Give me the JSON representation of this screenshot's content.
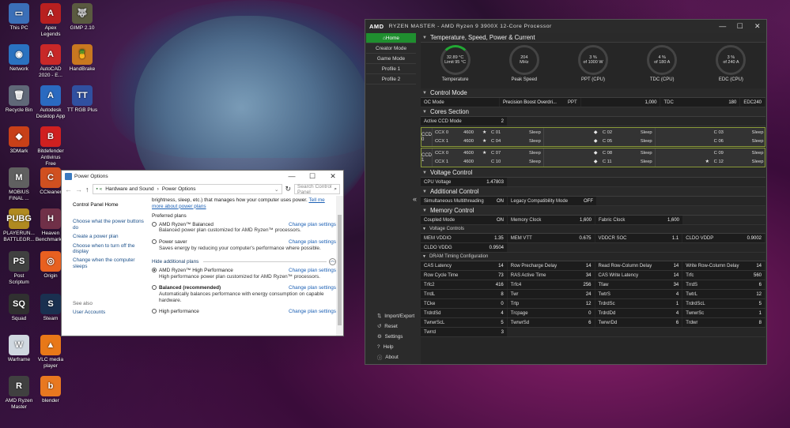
{
  "desktop": {
    "icons": [
      {
        "label": "This PC",
        "glyph": "▭",
        "color": "#3b6fb8"
      },
      {
        "label": "Apex Legends",
        "glyph": "A",
        "color": "#b82020"
      },
      {
        "label": "GIMP 2.10",
        "glyph": "🐺",
        "color": "#5a5a40"
      },
      {
        "label": "Network",
        "glyph": "◉",
        "color": "#2a72c0"
      },
      {
        "label": "AutoCAD 2020 - E...",
        "glyph": "A",
        "color": "#c82828"
      },
      {
        "label": "HandBrake",
        "glyph": "🍍",
        "color": "#c87820"
      },
      {
        "label": "Recycle Bin",
        "glyph": "🗑",
        "color": "#606878"
      },
      {
        "label": "Autodesk Desktop App",
        "glyph": "A",
        "color": "#2a6ac0"
      },
      {
        "label": "TT RGB Plus",
        "glyph": "TT",
        "color": "#3050a0"
      },
      {
        "label": "3DMark",
        "glyph": "◆",
        "color": "#c84018"
      },
      {
        "label": "Bitdefender Antivirus Free",
        "glyph": "B",
        "color": "#d02020"
      },
      {
        "label": "MOBIUS FINAL ...",
        "glyph": "M",
        "color": "#606060"
      },
      {
        "label": "CCleaner",
        "glyph": "C",
        "color": "#d05020"
      },
      {
        "label": "PLAYERUN... BATTLEGR...",
        "glyph": "PUBG",
        "color": "#b08a20"
      },
      {
        "label": "Heaven Benchmark...",
        "glyph": "H",
        "color": "#703048"
      },
      {
        "label": "Post Scriptum",
        "glyph": "PS",
        "color": "#404040"
      },
      {
        "label": "Origin",
        "glyph": "◎",
        "color": "#e86020"
      },
      {
        "label": "Squad",
        "glyph": "SQ",
        "color": "#303030"
      },
      {
        "label": "Steam",
        "glyph": "S",
        "color": "#1a3050"
      },
      {
        "label": "Warframe",
        "glyph": "W",
        "color": "#d0d8e0"
      },
      {
        "label": "VLC media player",
        "glyph": "▲",
        "color": "#e87818"
      },
      {
        "label": "AMD Ryzen Master",
        "glyph": "R",
        "color": "#404040"
      },
      {
        "label": "blender",
        "glyph": "b",
        "color": "#e87820"
      }
    ]
  },
  "power": {
    "title": "Power Options",
    "breadcrumb": [
      "Hardware and Sound",
      "Power Options"
    ],
    "search_placeholder": "Search Control Panel",
    "side_home": "Control Panel Home",
    "side_links": [
      "Choose what the power buttons do",
      "Create a power plan",
      "Choose when to turn off the display",
      "Change when the computer sleeps"
    ],
    "see_also": "See also",
    "user_accounts": "User Accounts",
    "intro": "brightness, sleep, etc.) that manages how your computer uses power.",
    "intro_link": "Tell me more about power plans",
    "preferred": "Preferred plans",
    "hide_additional": "Hide additional plans",
    "change_plan": "Change plan settings",
    "plans_pref": [
      {
        "name": "AMD Ryzen™ Balanced",
        "desc": "Balanced power plan customized for AMD Ryzen™ processors.",
        "selected": false
      },
      {
        "name": "Power saver",
        "desc": "Saves energy by reducing your computer's performance where possible.",
        "selected": false
      }
    ],
    "plans_add": [
      {
        "name": "AMD Ryzen™ High Performance",
        "desc": "High performance power plan customized for AMD Ryzen™ processors.",
        "selected": true
      },
      {
        "name": "Balanced (recommended)",
        "desc": "Automatically balances performance with energy consumption on capable hardware.",
        "selected": false
      },
      {
        "name": "High performance",
        "desc": "",
        "selected": false
      }
    ]
  },
  "rm": {
    "logo": "AMD",
    "title": "RYZEN MASTER  -  AMD Ryzen 9 3900X 12-Core Processor",
    "nav": [
      "Home",
      "Creator Mode",
      "Game Mode",
      "Profile 1",
      "Profile 2"
    ],
    "nav_bottom": [
      {
        "i": "⇅",
        "l": "Import/Export"
      },
      {
        "i": "↺",
        "l": "Reset"
      },
      {
        "i": "⚙",
        "l": "Settings"
      },
      {
        "i": "?",
        "l": "Help"
      },
      {
        "i": "ⓘ",
        "l": "About"
      }
    ],
    "sec_tsp": "Temperature, Speed, Power & Current",
    "gauges": [
      {
        "v1": "32.89 °C",
        "v2": "Limit 95 °C",
        "label": "Temperature",
        "style": "lo"
      },
      {
        "v1": "204",
        "v2": "MHz",
        "label": "Peak Speed",
        "style": "none"
      },
      {
        "v1": "3 %",
        "v2": "of 1000 W",
        "label": "PPT (CPU)",
        "style": "none"
      },
      {
        "v1": "4 %",
        "v2": "of 180 A",
        "label": "TDC (CPU)",
        "style": "none"
      },
      {
        "v1": "3 %",
        "v2": "of 240 A",
        "label": "EDC (CPU)",
        "style": "none"
      }
    ],
    "sec_control": "Control Mode",
    "oc_mode_label": "OC Mode",
    "oc_mode_value": "Precision Boost Overdri...",
    "ppt_label": "PPT",
    "ppt_value": "1,000",
    "tdc_label": "TDC",
    "tdc_value": "180",
    "edc_label": "EDC",
    "edc_value": "240",
    "sec_cores": "Cores Section",
    "active_ccd_label": "Active CCD Mode",
    "active_ccd_value": "2",
    "ccds": [
      {
        "name": "CCD 0",
        "cores": [
          {
            "ccx": "CCX 0",
            "mhz": "4600",
            "star": "★",
            "core": "C 01",
            "state": "Sleep"
          },
          {
            "ccx": "",
            "mhz": "",
            "star": "◆",
            "core": "C 02",
            "state": "Sleep"
          },
          {
            "ccx": "",
            "mhz": "",
            "star": "",
            "core": "C 03",
            "state": "Sleep"
          },
          {
            "ccx": "CCX 1",
            "mhz": "4600",
            "star": "★",
            "core": "C 04",
            "state": "Sleep"
          },
          {
            "ccx": "",
            "mhz": "",
            "star": "◆",
            "core": "C 05",
            "state": "Sleep"
          },
          {
            "ccx": "",
            "mhz": "",
            "star": "",
            "core": "C 06",
            "state": "Sleep"
          }
        ]
      },
      {
        "name": "CCD 1",
        "cores": [
          {
            "ccx": "CCX 0",
            "mhz": "4600",
            "star": "★",
            "core": "C 07",
            "state": "Sleep"
          },
          {
            "ccx": "",
            "mhz": "",
            "star": "◆",
            "core": "C 08",
            "state": "Sleep"
          },
          {
            "ccx": "",
            "mhz": "",
            "star": "",
            "core": "C 09",
            "state": "Sleep"
          },
          {
            "ccx": "CCX 1",
            "mhz": "4600",
            "star": "",
            "core": "C 10",
            "state": "Sleep"
          },
          {
            "ccx": "",
            "mhz": "",
            "star": "◆",
            "core": "C 11",
            "state": "Sleep"
          },
          {
            "ccx": "",
            "mhz": "",
            "star": "★",
            "core": "C 12",
            "state": "Sleep"
          }
        ]
      }
    ],
    "sec_voltage": "Voltage Control",
    "cpu_voltage_label": "CPU Voltage",
    "cpu_voltage_value": "1.47803",
    "sec_additional": "Additional Control",
    "smt_label": "Simultaneous Multithreading",
    "smt_value": "ON",
    "legacy_label": "Legacy Compatibility Mode",
    "legacy_value": "OFF",
    "sec_memory": "Memory Control",
    "mem_row": [
      {
        "l": "Coupled Mode",
        "v": "ON"
      },
      {
        "l": "Memory Clock",
        "v": "1,600"
      },
      {
        "l": "Fabric Clock",
        "v": "1,600"
      }
    ],
    "sub_volt": "Voltage Controls",
    "volt_rows": [
      [
        {
          "l": "MEM VDDIO",
          "v": "1.35"
        },
        {
          "l": "MEM VTT",
          "v": "0.675"
        },
        {
          "l": "VDDCR SOC",
          "v": "1.1"
        },
        {
          "l": "CLDO VDDP",
          "v": "0.9002"
        }
      ],
      [
        {
          "l": "CLDO VDDG",
          "v": "0.9504"
        }
      ]
    ],
    "sub_dram": "DRAM Timing Configuration",
    "dram_rows": [
      [
        {
          "l": "CAS Latency",
          "v": "14"
        },
        {
          "l": "Row Precharge Delay",
          "v": "14"
        },
        {
          "l": "Read Row-Column Delay",
          "v": "14"
        },
        {
          "l": "Write Row-Column Delay",
          "v": "14"
        }
      ],
      [
        {
          "l": "Row Cycle Time",
          "v": "73"
        },
        {
          "l": "RAS Active Time",
          "v": "34"
        },
        {
          "l": "CAS Write Latency",
          "v": "14"
        },
        {
          "l": "Trfc",
          "v": "560"
        }
      ],
      [
        {
          "l": "Trfc2",
          "v": "416"
        },
        {
          "l": "Trfc4",
          "v": "256"
        },
        {
          "l": "Tfaw",
          "v": "34"
        },
        {
          "l": "TrrdS",
          "v": "6"
        }
      ],
      [
        {
          "l": "TrrdL",
          "v": "8"
        },
        {
          "l": "Twr",
          "v": "24"
        },
        {
          "l": "TwtrS",
          "v": "4"
        },
        {
          "l": "TwtrL",
          "v": "12"
        }
      ],
      [
        {
          "l": "TCke",
          "v": "0"
        },
        {
          "l": "Trtp",
          "v": "12"
        },
        {
          "l": "TrdrdSc",
          "v": "1"
        },
        {
          "l": "TrdrdScL",
          "v": "5"
        }
      ],
      [
        {
          "l": "TrdrdSd",
          "v": "4"
        },
        {
          "l": "Trcpage",
          "v": "0"
        },
        {
          "l": "TrdrdDd",
          "v": "4"
        },
        {
          "l": "TwrwrSc",
          "v": "1"
        }
      ],
      [
        {
          "l": "TwrwrScL",
          "v": "5"
        },
        {
          "l": "TwrwrSd",
          "v": "6"
        },
        {
          "l": "TwrwrDd",
          "v": "6"
        },
        {
          "l": "Trdwr",
          "v": "8"
        }
      ],
      [
        {
          "l": "Twrrd",
          "v": "3"
        }
      ]
    ]
  }
}
